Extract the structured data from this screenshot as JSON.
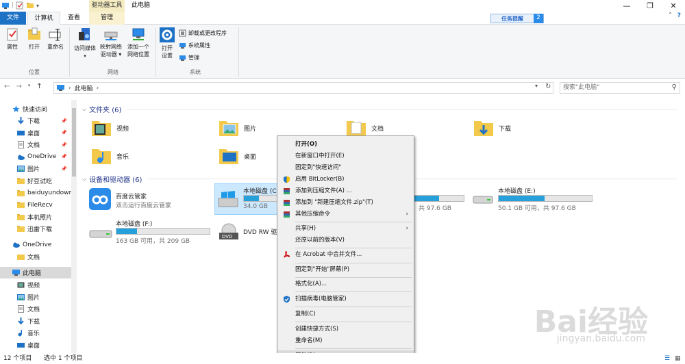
{
  "window": {
    "title": "此电脑",
    "context_tab_group": "驱动器工具"
  },
  "ribbon_tabs": {
    "file": "文件",
    "computer": "计算机",
    "view": "查看",
    "manage": "管理"
  },
  "task_button": {
    "label": "任务提醒",
    "count": "2"
  },
  "ribbon": {
    "location": {
      "label": "位置",
      "properties": "属性",
      "open": "打开",
      "rename": "重命名"
    },
    "network": {
      "label": "网络",
      "access_media": "访问媒体",
      "map_drive_1": "映射网络",
      "map_drive_2": "驱动器",
      "add_location_1": "添加一个",
      "add_location_2": "网络位置"
    },
    "system": {
      "label": "系统",
      "open_settings_1": "打开",
      "open_settings_2": "设置",
      "uninstall": "卸载或更改程序",
      "system_props": "系统属性",
      "manage": "管理"
    }
  },
  "address": {
    "path": "此电脑",
    "search_placeholder": "搜索\"此电脑\""
  },
  "nav": {
    "quick_access": "快速访问",
    "items": [
      {
        "label": "下载",
        "icon": "download-arrow-icon"
      },
      {
        "label": "桌面",
        "icon": "desktop-icon"
      },
      {
        "label": "文档",
        "icon": "document-icon"
      },
      {
        "label": "OneDrive",
        "icon": "onedrive-icon"
      },
      {
        "label": "图片",
        "icon": "pictures-icon"
      },
      {
        "label": "好豆试吃",
        "icon": "folder-icon"
      },
      {
        "label": "baiduyundownl",
        "icon": "folder-icon"
      },
      {
        "label": "FileRecv",
        "icon": "folder-icon"
      },
      {
        "label": "本机照片",
        "icon": "folder-icon"
      },
      {
        "label": "迅雷下载",
        "icon": "folder-icon"
      }
    ],
    "onedrive": "OneDrive",
    "onedrive_docs": "文档",
    "this_pc": "此电脑",
    "pc_items": [
      {
        "label": "视频",
        "icon": "video-icon"
      },
      {
        "label": "图片",
        "icon": "pictures-icon"
      },
      {
        "label": "文档",
        "icon": "document-icon"
      },
      {
        "label": "下载",
        "icon": "download-arrow-icon"
      },
      {
        "label": "音乐",
        "icon": "music-icon"
      },
      {
        "label": "桌面",
        "icon": "desktop-icon"
      }
    ]
  },
  "folders_section": {
    "title": "文件夹 (6)",
    "items": [
      "视频",
      "图片",
      "文档",
      "下载",
      "音乐",
      "桌面"
    ]
  },
  "drives_section": {
    "title": "设备和驱动器 (6)",
    "baidu": {
      "name": "百度云管家",
      "desc": "双击运行百度云管家"
    },
    "drive_c": {
      "name": "本地磁盘 (C:",
      "size": "34.0 GB",
      "fill": 0.28
    },
    "drive_d": {
      "size": "共 97.6 GB",
      "fill": 0.5
    },
    "drive_e": {
      "name": "本地磁盘 (E:)",
      "size": "50.1 GB 可用，共 97.6 GB",
      "fill": 0.49
    },
    "drive_f": {
      "name": "本地磁盘 (F:)",
      "size": "163 GB 可用，共 209 GB",
      "fill": 0.22
    },
    "dvd": {
      "name": "DVD RW 驱"
    }
  },
  "context_menu": {
    "open": "打开(O)",
    "open_new_window": "在新窗口中打开(E)",
    "pin_quick": "固定到\"快速访问\"",
    "bitlocker": "启用 BitLocker(B)",
    "add_archive": "添加到压缩文件(A) ...",
    "add_zip": "添加到 \"新建压缩文件.zip\"(T)",
    "other_compress": "其他压缩命令",
    "share": "共享(H)",
    "restore": "还原以前的版本(V)",
    "acrobat": "在 Acrobat 中合并文件...",
    "pin_start": "固定到\"开始\"屏幕(P)",
    "format": "格式化(A)...",
    "scan": "扫描病毒(电脑管家)",
    "copy": "复制(C)",
    "shortcut": "创建快捷方式(S)",
    "rename": "重命名(M)",
    "properties": "属性(R)"
  },
  "status": {
    "count": "12 个项目",
    "selected": "选中 1 个项目"
  },
  "watermark": {
    "brand": "Bai经验",
    "url": "jingyan.baidu.com"
  },
  "colors": {
    "accent": "#1e72c6",
    "drive_fill": "#26a0da",
    "menu_bg": "#f0f0f0"
  }
}
